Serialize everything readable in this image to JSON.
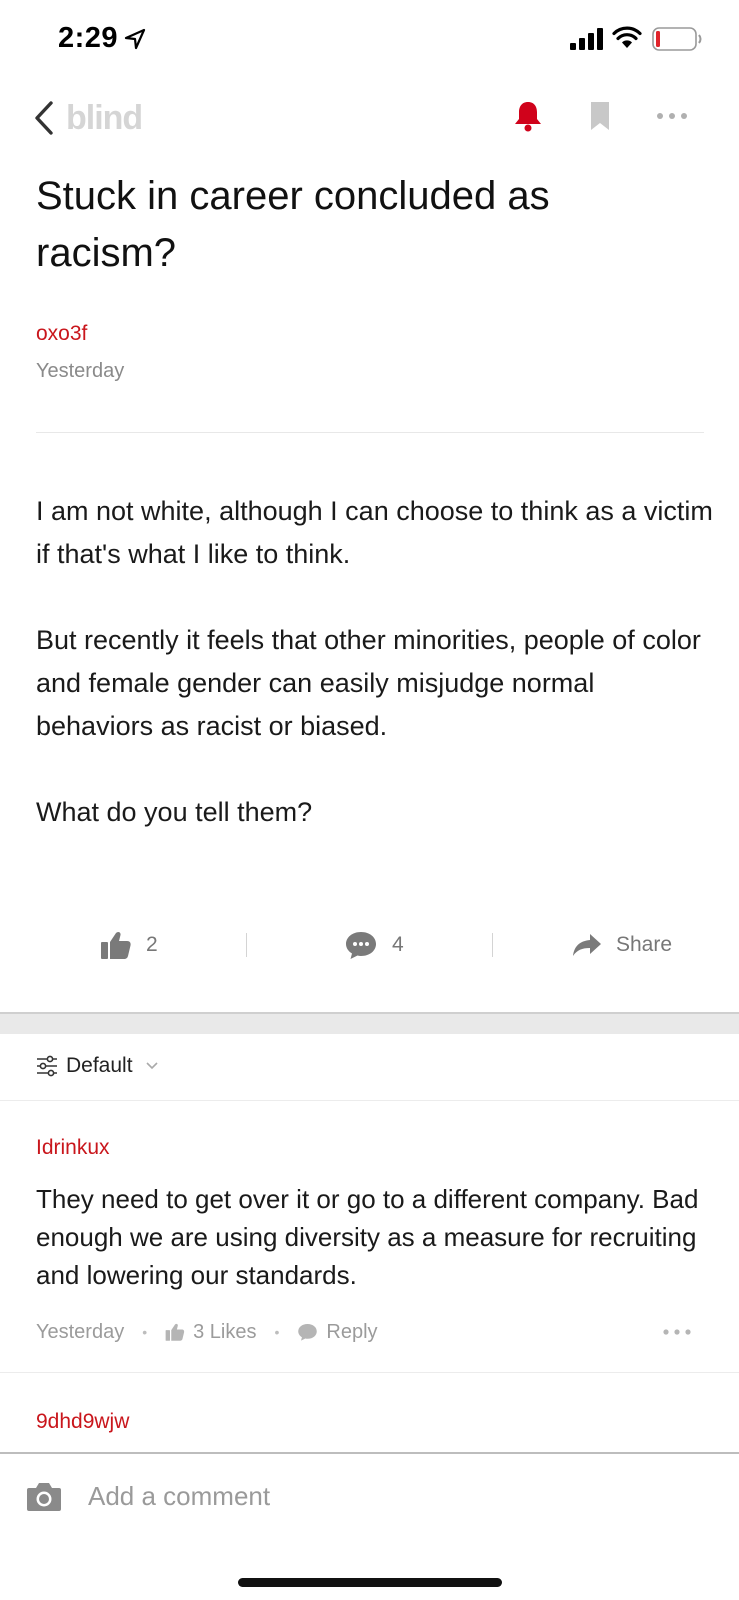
{
  "status_bar": {
    "time": "2:29",
    "icons": [
      "location-arrow-icon",
      "cellular-signal-icon",
      "wifi-icon",
      "battery-low-icon"
    ]
  },
  "nav": {
    "brand": "blind",
    "icons": [
      "back-chevron-icon",
      "bell-icon",
      "bookmark-icon",
      "more-dots-icon"
    ],
    "accent_color": "#d0021b"
  },
  "post": {
    "title": "Stuck in career concluded as racism?",
    "author": "oxo3f",
    "time": "Yesterday",
    "body": [
      "I am not white, although I can choose to think as a victim if that's what I like to think.",
      "But recently it feels that other minorities, people of color and female gender can easily misjudge normal behaviors as racist or biased.",
      "What do you tell them?"
    ],
    "actions": {
      "likes": "2",
      "comments": "4",
      "share_label": "Share"
    }
  },
  "sort": {
    "label": "Default"
  },
  "comments": [
    {
      "author": "Idrinkux",
      "body": "They need to get over it or go to a different company. Bad enough we are using diversity as a measure for recruiting and lowering our standards.",
      "time": "Yesterday",
      "likes_label": "3 Likes",
      "reply_label": "Reply"
    },
    {
      "author": "9dhd9wjw"
    }
  ],
  "composer": {
    "placeholder": "Add a comment"
  }
}
